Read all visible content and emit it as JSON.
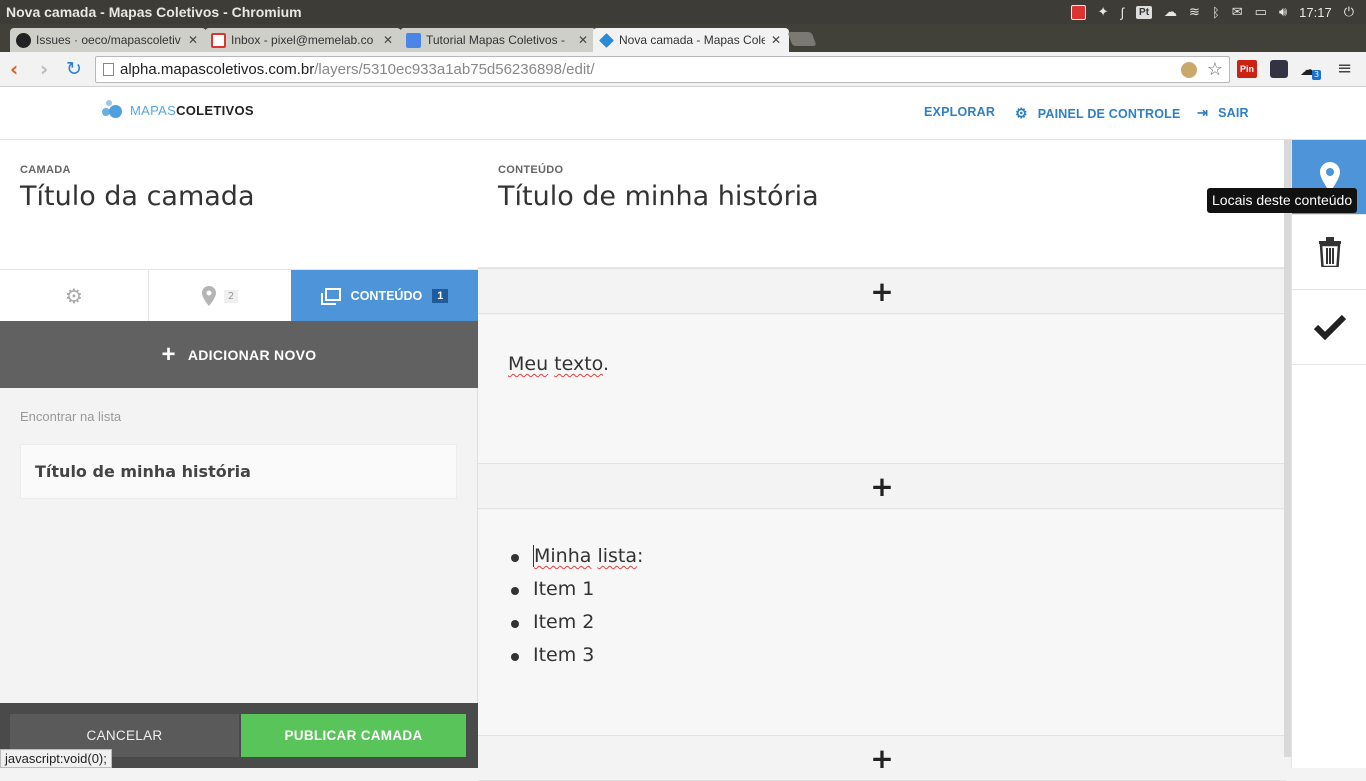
{
  "os": {
    "window_title": "Nova camada - Mapas Coletivos - Chromium",
    "pt_label": "Pt",
    "clock": "17:17"
  },
  "browser": {
    "tabs": [
      {
        "label": "Issues · oeco/mapascoletiv"
      },
      {
        "label": "Inbox - pixel@memelab.co"
      },
      {
        "label": "Tutorial Mapas Coletivos -"
      },
      {
        "label": "Nova camada - Mapas Cole"
      }
    ],
    "url_host": "alpha.mapascoletivos.com.br",
    "url_path": "/layers/5310ec933a1ab75d56236898/edit/",
    "ext_pin_label": "Pin",
    "ext_badge": "3",
    "status_url": "javascript:void(0);"
  },
  "app": {
    "logo_part1": "MAPAS",
    "logo_part2": "COLETIVOS",
    "nav": {
      "explore": "EXPLORAR",
      "dashboard": "PAINEL DE CONTROLE",
      "logout": "SAIR"
    }
  },
  "layer": {
    "kicker": "CAMADA",
    "title": "Título da camada",
    "locals_count": "2",
    "content_tab_label": "CONTEÚDO",
    "content_count": "1",
    "add_new_label": "ADICIONAR NOVO",
    "find_placeholder": "Encontrar na lista",
    "items": [
      {
        "title": "Título de minha história"
      }
    ],
    "cancel_label": "CANCELAR",
    "publish_label": "PUBLICAR CAMADA"
  },
  "content": {
    "kicker": "CONTEÚDO",
    "title": "Título de minha história",
    "text_block": {
      "word1": "Meu",
      "word2": "texto",
      "rest": "."
    },
    "list_block": {
      "first_word": "Minha",
      "first_rest_word": "lista",
      "first_suffix": ":",
      "items": [
        "Item 1",
        "Item 2",
        "Item 3"
      ]
    },
    "add_symbol": "+"
  },
  "rail": {
    "tooltip": "Locais deste conteúdo"
  }
}
